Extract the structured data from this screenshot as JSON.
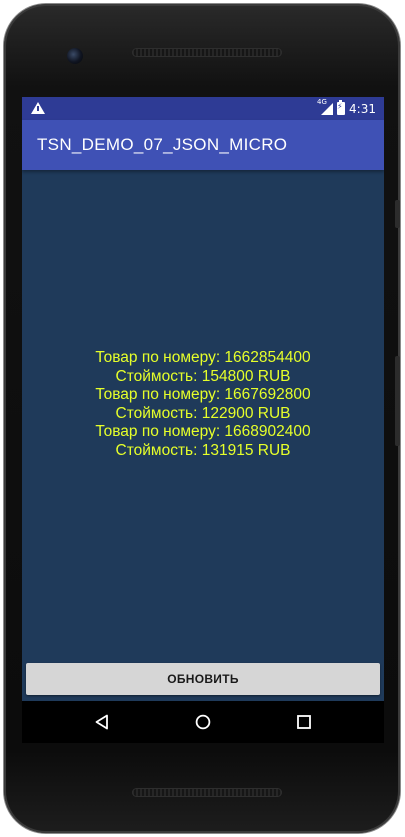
{
  "status_bar": {
    "time": "4:31",
    "warning_icon": "warning-icon",
    "network_label": "4G",
    "battery_icon": "battery-charging-icon"
  },
  "app_bar": {
    "title": "TSN_DEMO_07_JSON_MICRO"
  },
  "content": {
    "lines": [
      "Товар по номеру: 1662854400",
      "Стоймость: 154800 RUB",
      "Товар по номеру: 1667692800",
      "Стоймость: 122900 RUB",
      "Товар по номеру: 1668902400",
      "Стоймость: 131915 RUB"
    ]
  },
  "refresh_button": {
    "label": "ОБНОВИТЬ"
  },
  "colors": {
    "status_bar": "#2e3b95",
    "app_bar": "#3f51b5",
    "background": "#1f3a5a",
    "text": "#e6ff2a",
    "button": "#d6d6d6"
  }
}
